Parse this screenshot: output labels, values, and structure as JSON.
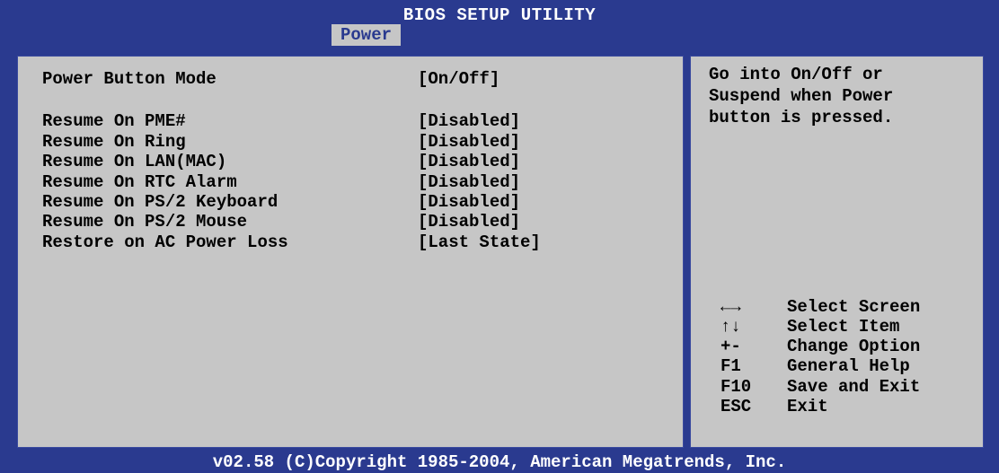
{
  "header": {
    "title": "BIOS SETUP UTILITY",
    "active_tab": "Power"
  },
  "settings": [
    {
      "label": "Power Button Mode",
      "value": "[On/Off]"
    },
    {
      "label": "Resume On PME#",
      "value": "[Disabled]"
    },
    {
      "label": "Resume On Ring",
      "value": "[Disabled]"
    },
    {
      "label": "Resume On LAN(MAC)",
      "value": "[Disabled]"
    },
    {
      "label": "Resume On RTC Alarm",
      "value": "[Disabled]"
    },
    {
      "label": "Resume On PS/2 Keyboard",
      "value": "[Disabled]"
    },
    {
      "label": "Resume On PS/2 Mouse",
      "value": "[Disabled]"
    },
    {
      "label": "Restore on AC Power Loss",
      "value": "[Last State]"
    }
  ],
  "help": {
    "lines": [
      "Go into On/Off or",
      "Suspend when Power",
      "button is pressed."
    ]
  },
  "keys": [
    {
      "key": "←→",
      "desc": "Select Screen"
    },
    {
      "key": "↑↓",
      "desc": "Select Item"
    },
    {
      "key": "+-",
      "desc": "Change Option"
    },
    {
      "key": "F1",
      "desc": "General Help"
    },
    {
      "key": "F10",
      "desc": "Save and Exit"
    },
    {
      "key": "ESC",
      "desc": "Exit"
    }
  ],
  "footer": {
    "text": "v02.58 (C)Copyright 1985-2004, American Megatrends, Inc."
  },
  "colors": {
    "frame_blue": "#2a3a8f",
    "panel_gray": "#c6c6c6",
    "text": "#000000",
    "header_text": "#ffffff"
  }
}
